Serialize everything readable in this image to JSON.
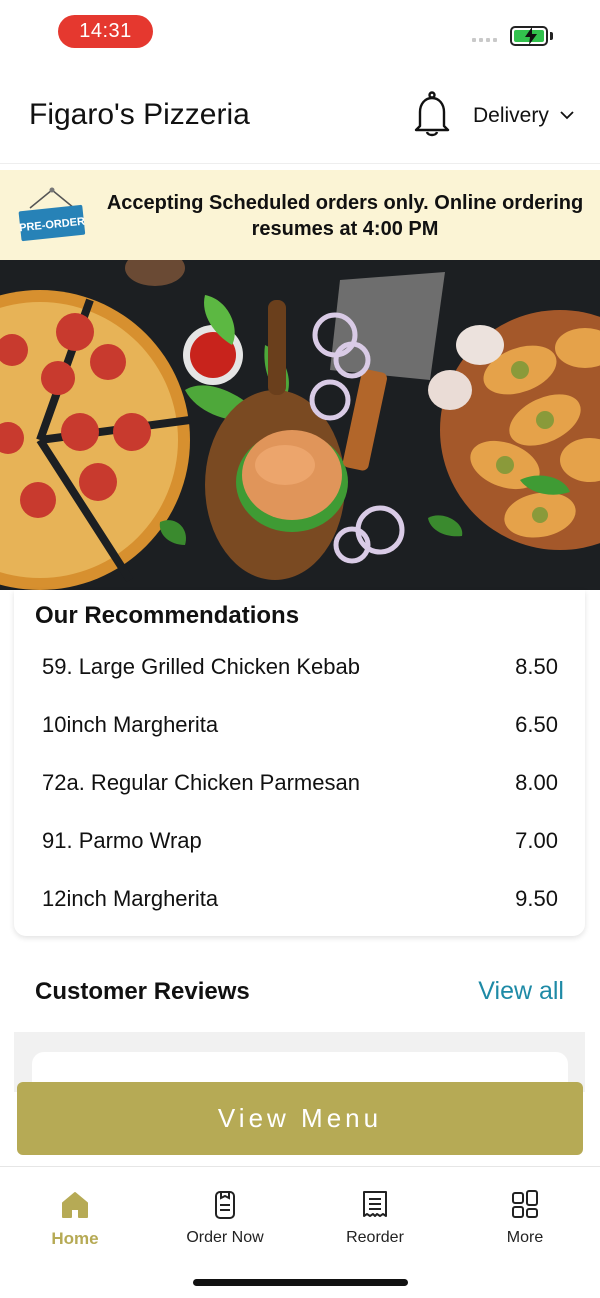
{
  "status_bar": {
    "time": "14:31"
  },
  "header": {
    "title": "Figaro's Pizzeria",
    "mode": "Delivery"
  },
  "banner": {
    "badge": "PRE-ORDER",
    "message": "Accepting Scheduled orders only. Online ordering resumes at 4:00 PM"
  },
  "recommendations": {
    "title": "Our Recommendations",
    "items": [
      {
        "name": "59. Large Grilled Chicken Kebab",
        "price": "8.50"
      },
      {
        "name": "10inch Margherita",
        "price": "6.50"
      },
      {
        "name": "72a. Regular Chicken Parmesan",
        "price": "8.00"
      },
      {
        "name": "91. Parmo Wrap",
        "price": "7.00"
      },
      {
        "name": "12inch Margherita",
        "price": "9.50"
      }
    ]
  },
  "reviews": {
    "title": "Customer Reviews",
    "view_all": "View all"
  },
  "view_menu_label": "View Menu",
  "tabs": [
    {
      "label": "Home",
      "icon": "home-icon"
    },
    {
      "label": "Order Now",
      "icon": "phone-order-icon"
    },
    {
      "label": "Reorder",
      "icon": "receipt-icon"
    },
    {
      "label": "More",
      "icon": "grid-icon"
    }
  ],
  "colors": {
    "accent": "#b6aa55",
    "link": "#1e8aa6",
    "banner_bg": "#fbf4d5",
    "time_pill": "#e5382f"
  }
}
